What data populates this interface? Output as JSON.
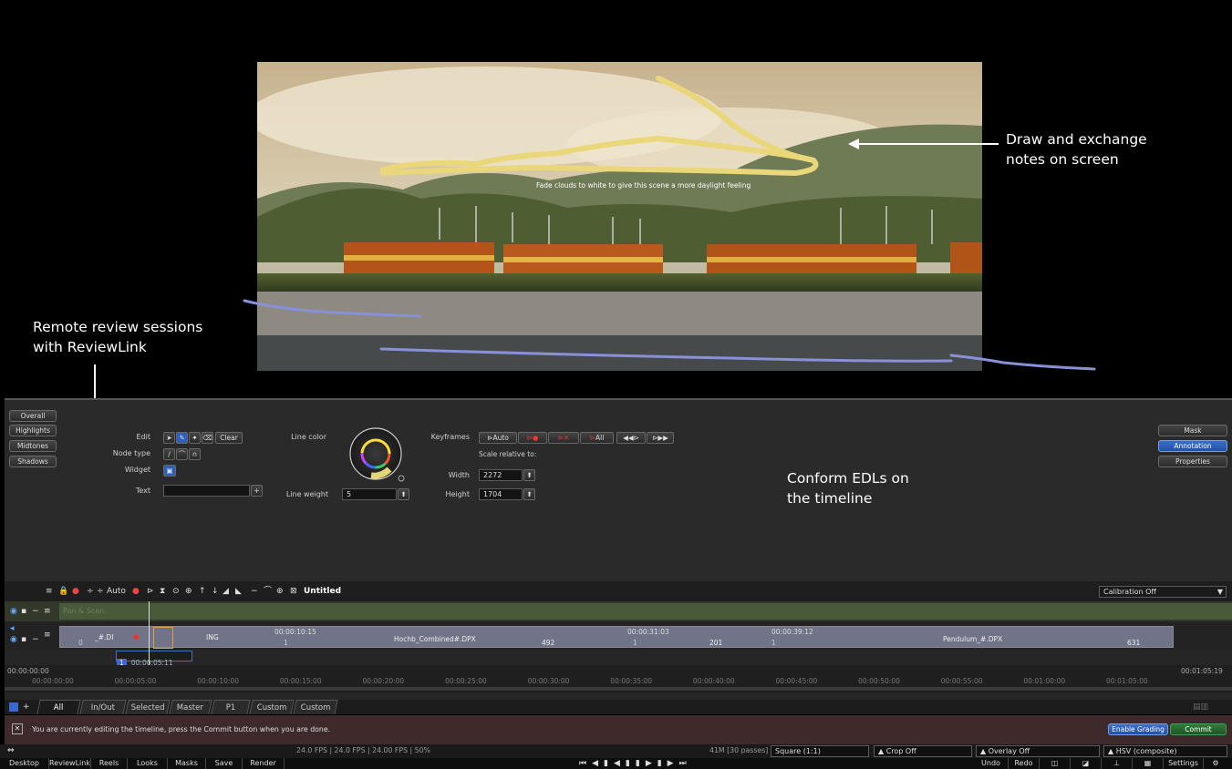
{
  "annotations": {
    "draw_notes_line1": "Draw and exchange",
    "draw_notes_line2": "notes on screen",
    "remote_line1": "Remote review sessions",
    "remote_line2": "with ReviewLink",
    "conform_line1": "Conform EDLs on",
    "conform_line2": "the timeline",
    "on_image_note": "Fade clouds to white to give this scene a more daylight feeling"
  },
  "grading_tabs": {
    "overall": "Overall",
    "highlights": "Highlights",
    "midtones": "Midtones",
    "shadows": "Shadows"
  },
  "right_tabs": {
    "mask": "Mask",
    "annotation": "Annotation",
    "properties": "Properties"
  },
  "annotation_panel": {
    "edit_label": "Edit",
    "clear_label": "Clear",
    "node_type_label": "Node type",
    "widget_label": "Widget",
    "text_label": "Text",
    "line_color_label": "Line color",
    "line_weight_label": "Line weight",
    "line_weight_value": "5",
    "keyframes_label": "Keyframes",
    "kf_auto": "Auto",
    "kf_all": "All",
    "scale_relative": "Scale relative to:",
    "width_label": "Width",
    "width_value": "2272",
    "height_label": "Height",
    "height_value": "1704"
  },
  "timeline": {
    "toolbar_auto": "Auto",
    "title": "Untitled",
    "calibration": "Calibration Off",
    "track_pan_scan": "Pan & Scan",
    "clip1_name": "_#.DI",
    "clip2_name": "ING",
    "clip3_tc": "00:00:10:15",
    "clip3_name": "Hochb_Combined#.DPX",
    "clip3_count": "492",
    "clip4_tc": "00:00:31:03",
    "clip4_count": "201",
    "clip5_tc": "00:00:39:12",
    "clip5_name": "Pendulum_#.DPX",
    "clip5_count": "631",
    "num_zero": "0",
    "num_one": "1",
    "cursor_index": "1",
    "cursor_tc": "00:00:05:11",
    "start_tc": "00:00:00:00",
    "end_tc": "00:01:05:19",
    "ruler": [
      "00:00:00:00",
      "00:00:05:00",
      "00:00:10:00",
      "00:00:15:00",
      "00:00:20:00",
      "00:00:25:00",
      "00:00:30:00",
      "00:00:35:00",
      "00:00:40:00",
      "00:00:45:00",
      "00:00:50:00",
      "00:00:55:00",
      "00:01:00:00",
      "00:01:05:00"
    ]
  },
  "bin_tabs": [
    "All",
    "In/Out",
    "Selected",
    "Master",
    "P1",
    "Custom",
    "Custom"
  ],
  "status_message": "You are currently editing the timeline, press the Commit button when you are done.",
  "enable_grading": "Enable Grading",
  "commit": "Commit",
  "info_bar": {
    "fps": "24.0 FPS  |  24.0 FPS  |  24.00 FPS  |  50%",
    "passes": "41M [30 passes]",
    "pixel_aspect": "Square (1:1)",
    "crop": "Crop Off",
    "overlay": "Overlay Off",
    "colorspace": "HSV (composite)"
  },
  "bottom_bar": [
    "Desktop",
    "ReviewLink",
    "Reels",
    "Looks",
    "Masks",
    "Save",
    "Render"
  ],
  "bottom_right": {
    "undo": "Undo",
    "redo": "Redo",
    "settings": "Settings"
  }
}
